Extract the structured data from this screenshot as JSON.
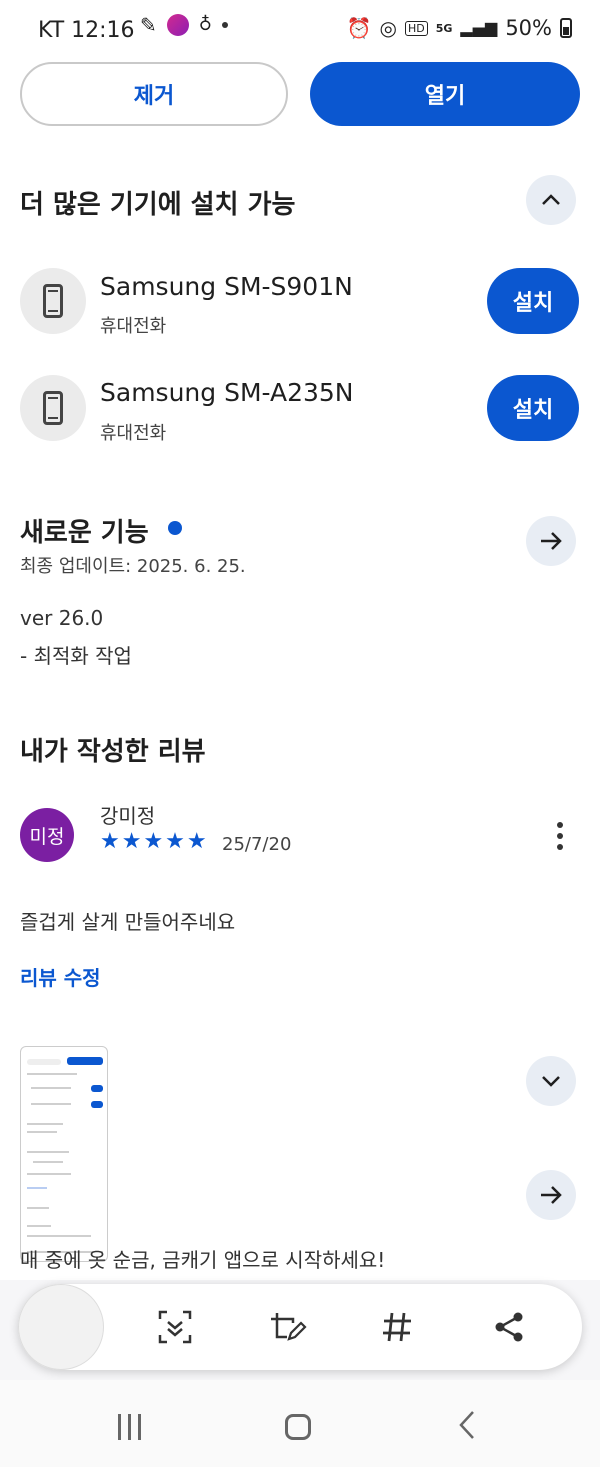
{
  "status_bar": {
    "carrier_time": "KT 12:16",
    "network": "5G",
    "battery": "50%"
  },
  "actions": {
    "remove_label": "제거",
    "open_label": "열기"
  },
  "devices_section": {
    "title": "더 많은 기기에 설치 가능",
    "devices": [
      {
        "name": "Samsung SM-S901N",
        "type": "휴대전화",
        "button": "설치"
      },
      {
        "name": "Samsung SM-A235N",
        "type": "휴대전화",
        "button": "설치"
      }
    ]
  },
  "whats_new": {
    "title": "새로운 기능",
    "last_updated": "최종 업데이트: 2025. 6. 25.",
    "version": "ver 26.0",
    "notes": "- 최적화 작업"
  },
  "my_review": {
    "title": "내가 작성한 리뷰",
    "author": "강미정",
    "avatar_text": "미정",
    "stars": "★★★★★",
    "rating": 5,
    "date": "25/7/20",
    "text": "즐겁게 살게 만들어주네요",
    "edit_label": "리뷰 수정"
  },
  "partial_text": "매 중에 옷 순금, 금캐기 앱으로 시작하세요!",
  "colors": {
    "accent": "#0b57d0",
    "avatar": "#7b1fa2"
  }
}
